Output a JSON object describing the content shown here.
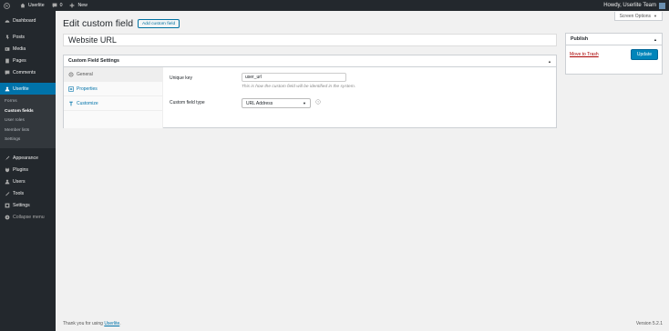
{
  "adminbar": {
    "site_name": "Userlite",
    "comments_count": "0",
    "new_label": "New",
    "howdy": "Howdy, Userlite Team"
  },
  "sidebar": {
    "items_top": [
      {
        "label": "Dashboard",
        "icon": "dashboard-icon"
      },
      {
        "label": "Posts",
        "icon": "pin-icon"
      },
      {
        "label": "Media",
        "icon": "media-icon"
      },
      {
        "label": "Pages",
        "icon": "pages-icon"
      },
      {
        "label": "Comments",
        "icon": "comments-icon"
      }
    ],
    "current": {
      "label": "Userlite",
      "icon": "user-icon"
    },
    "submenu": [
      "Forms",
      "Custom fields",
      "User roles",
      "Member lists",
      "Settings"
    ],
    "items_bottom": [
      {
        "label": "Appearance",
        "icon": "brush-icon"
      },
      {
        "label": "Plugins",
        "icon": "plugin-icon"
      },
      {
        "label": "Users",
        "icon": "users-icon"
      },
      {
        "label": "Tools",
        "icon": "tools-icon"
      },
      {
        "label": "Settings",
        "icon": "settings-icon"
      }
    ],
    "collapse_label": "Collapse menu"
  },
  "screen_options": "Screen Options",
  "page": {
    "title": "Edit custom field",
    "add_button": "Add custom field",
    "post_title": "Website URL"
  },
  "settings_box": {
    "title": "Custom Field Settings",
    "tabs": [
      {
        "label": "General",
        "icon": "gear-icon"
      },
      {
        "label": "Properties",
        "icon": "list-icon"
      },
      {
        "label": "Customize",
        "icon": "text-icon"
      }
    ],
    "unique_key_label": "Unique key",
    "unique_key_value": "user_url",
    "unique_key_help": "This is how the custom field will be identified in the system.",
    "type_label": "Custom field type",
    "type_value": "URL Address"
  },
  "publish": {
    "title": "Publish",
    "trash": "Move to Trash",
    "update": "Update"
  },
  "footer": {
    "thanks_prefix": "Thank you for using",
    "thanks_link": "Userlite",
    "thanks_suffix": ".",
    "version": "Version 5.2.1"
  },
  "colors": {
    "accent": "#0073aa",
    "sidebar": "#23282d",
    "update_button": "#0085ba"
  }
}
